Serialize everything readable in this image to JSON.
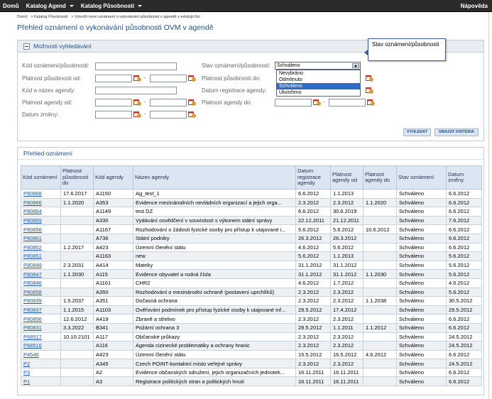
{
  "topbar": {
    "nav": [
      {
        "label": "Domů",
        "has_caret": false
      },
      {
        "label": "Katalog Agend",
        "has_caret": true
      },
      {
        "label": "Katalog Působností",
        "has_caret": true
      }
    ],
    "help": "Nápověda"
  },
  "breadcrumb": [
    "Domů",
    "> Katalog Působností",
    "> Vytvořit nové oznámení o vykonávání působnosti v agendě z existujícího"
  ],
  "page_title": "Přehled oznámení o vykonávání působnosti OVM v agendě",
  "search": {
    "header": "Možnosti vyhledávání",
    "labels": {
      "kod_oznameni": "Kód oznámení/působnosti:",
      "platnost_pusobnosti_od": "Platnost působnosti od:",
      "kod_nazev_agendy": "Kód a název agendy:",
      "platnost_agendy_od": "Platnost agendy od:",
      "datum_zmeny": "Datum změny:",
      "stav": "Stav oznámení/působnosti:",
      "platnost_pusobnosti_do": "Platnost působnosti do:",
      "datum_registrace": "Datum registrace agendy:",
      "platnost_agendy_do": "Platnost agendy do:"
    },
    "range_sep": "-",
    "stav_value": "Schváleno",
    "stav_options": [
      "Nevybráno",
      "Odmítnuto",
      "Schváleno",
      "Ukončeno"
    ],
    "stav_highlighted": "Schváleno",
    "tooltip": "Stav oznámení/působnosti",
    "buttons": {
      "search": "VYHLEDAT",
      "clear": "SMAZAT KRITÉRIA"
    }
  },
  "results": {
    "header": "Přehled oznámení",
    "columns": [
      "Kód oznámení",
      "Platnost působnosti do",
      "Kód agendy",
      "Název agendy",
      "Datum registrace agendy",
      "Platnost agendy od",
      "Platnost agendy do",
      "Stav oznámení",
      "Datum změny"
    ],
    "rows": [
      [
        "P80868",
        "17.6.2017",
        "A1150",
        "Ag_test_1",
        "6.6.2012",
        "1.1.2013",
        "",
        "Schváleno",
        "6.6.2012"
      ],
      [
        "P80866",
        "1.1.2020",
        "A353",
        "Evidence mezinárodních nevládních organizací a jejich orga...",
        "2.3.2012",
        "2.3.2012",
        "1.1.2020",
        "Schváleno",
        "6.6.2012"
      ],
      [
        "P80864",
        "",
        "A1149",
        "test DZ",
        "6.6.2012",
        "30.6.2019",
        "",
        "Schváleno",
        "6.6.2012"
      ],
      [
        "P80859",
        "",
        "A330",
        "Vydávání osvědčení v souvislosti s výkonem státní správy",
        "22.12.2011",
        "21.12.2011",
        "",
        "Schváleno",
        "7.6.2012"
      ],
      [
        "P80856",
        "",
        "A1167",
        "Rozhodování o žádosti fyzické osoby pro přístup k utajované i...",
        "5.6.2012",
        "5.6.2012",
        "10.6.2012",
        "Schváleno",
        "6.6.2012"
      ],
      [
        "P80861",
        "",
        "A736",
        "Státní podniky",
        "26.3.2012",
        "26.3.2012",
        "",
        "Schváleno",
        "6.6.2012"
      ],
      [
        "P80852",
        "1.2.2017",
        "A423",
        "Územní členění státu",
        "4.6.2012",
        "5.6.2012",
        "",
        "Schváleno",
        "6.6.2012"
      ],
      [
        "P80851",
        "",
        "A1163",
        "new",
        "5.6.2012",
        "1.1.2013",
        "",
        "Schváleno",
        "5.6.2012"
      ],
      [
        "P80849",
        "2.3.2031",
        "A414",
        "Matriky",
        "31.1.2012",
        "31.1.2012",
        "",
        "Schváleno",
        "5.6.2012"
      ],
      [
        "P80847",
        "1.1.2030",
        "A115",
        "Evidence obyvatel a rodná čísla",
        "31.1.2012",
        "31.1.2012",
        "1.1.2030",
        "Schváleno",
        "5.6.2012"
      ],
      [
        "P80846",
        "",
        "A1161",
        "CHR2",
        "4.6.2012",
        "1.7.2012",
        "",
        "Schváleno",
        "4.6.2012"
      ],
      [
        "P80858",
        "",
        "A350",
        "Rozhodování o mezinárodní ochraně (postavení uprchlíků)",
        "2.3.2012",
        "2.3.2012",
        "",
        "Schváleno",
        "5.6.2012"
      ],
      [
        "P80839",
        "1.5.2037",
        "A351",
        "Dočasná ochrana",
        "2.3.2012",
        "2.3.2012",
        "1.1.2038",
        "Schváleno",
        "30.5.2012"
      ],
      [
        "P80837",
        "1.1.2015",
        "A1103",
        "Ověřování podmínek pro přístup fyzické osoby k utajované inf...",
        "29.5.2012",
        "17.4.2012",
        "",
        "Schváleno",
        "29.5.2012"
      ],
      [
        "P80856",
        "12.6.2012",
        "A419",
        "Zbraně a střelivo",
        "2.3.2012",
        "2.3.2012",
        "",
        "Schváleno",
        "6.6.2012"
      ],
      [
        "P80831",
        "3.3.2022",
        "B341",
        "Požární ochrana 3",
        "28.5.2012",
        "1.1.2011",
        "1.1.2012",
        "Schváleno",
        "6.6.2012"
      ],
      [
        "P68517",
        "10.10.2101",
        "A117",
        "Občanské průkazy",
        "2.3.2012",
        "2.3.2012",
        "",
        "Schváleno",
        "24.5.2012"
      ],
      [
        "P68516",
        "",
        "A116",
        "Agenda cizinecké problematiky a ochrany hranic",
        "2.3.2012",
        "2.3.2012",
        "",
        "Schváleno",
        "24.5.2012"
      ],
      [
        "P4546",
        "",
        "A423",
        "Územní členění státu",
        "15.5.2012",
        "16.5.2012",
        "4.6.2012",
        "Schváleno",
        "6.6.2012"
      ],
      [
        "P2",
        "",
        "A345",
        "Czech POINT-kontaktní místo veřejné správy",
        "2.3.2012",
        "2.3.2012",
        "",
        "Schváleno",
        "24.5.2012"
      ],
      [
        "P3",
        "",
        "A2",
        "Evidence občanských sdružení, jejich organizačních jednotek...",
        "16.11.2011",
        "16.11.2011",
        "",
        "Schváleno",
        "6.6.2012"
      ],
      [
        "P1",
        "",
        "A3",
        "Registrace politických stran a politických hnutí",
        "16.11.2011",
        "16.11.2011",
        "",
        "Schváleno",
        "6.6.2012"
      ]
    ]
  },
  "colors": {
    "topbar": "#2b2b2b",
    "accent": "#1f4f88",
    "header_bg": "#dce6f2",
    "link": "#1a56b0",
    "highlight": "#3169c6"
  }
}
